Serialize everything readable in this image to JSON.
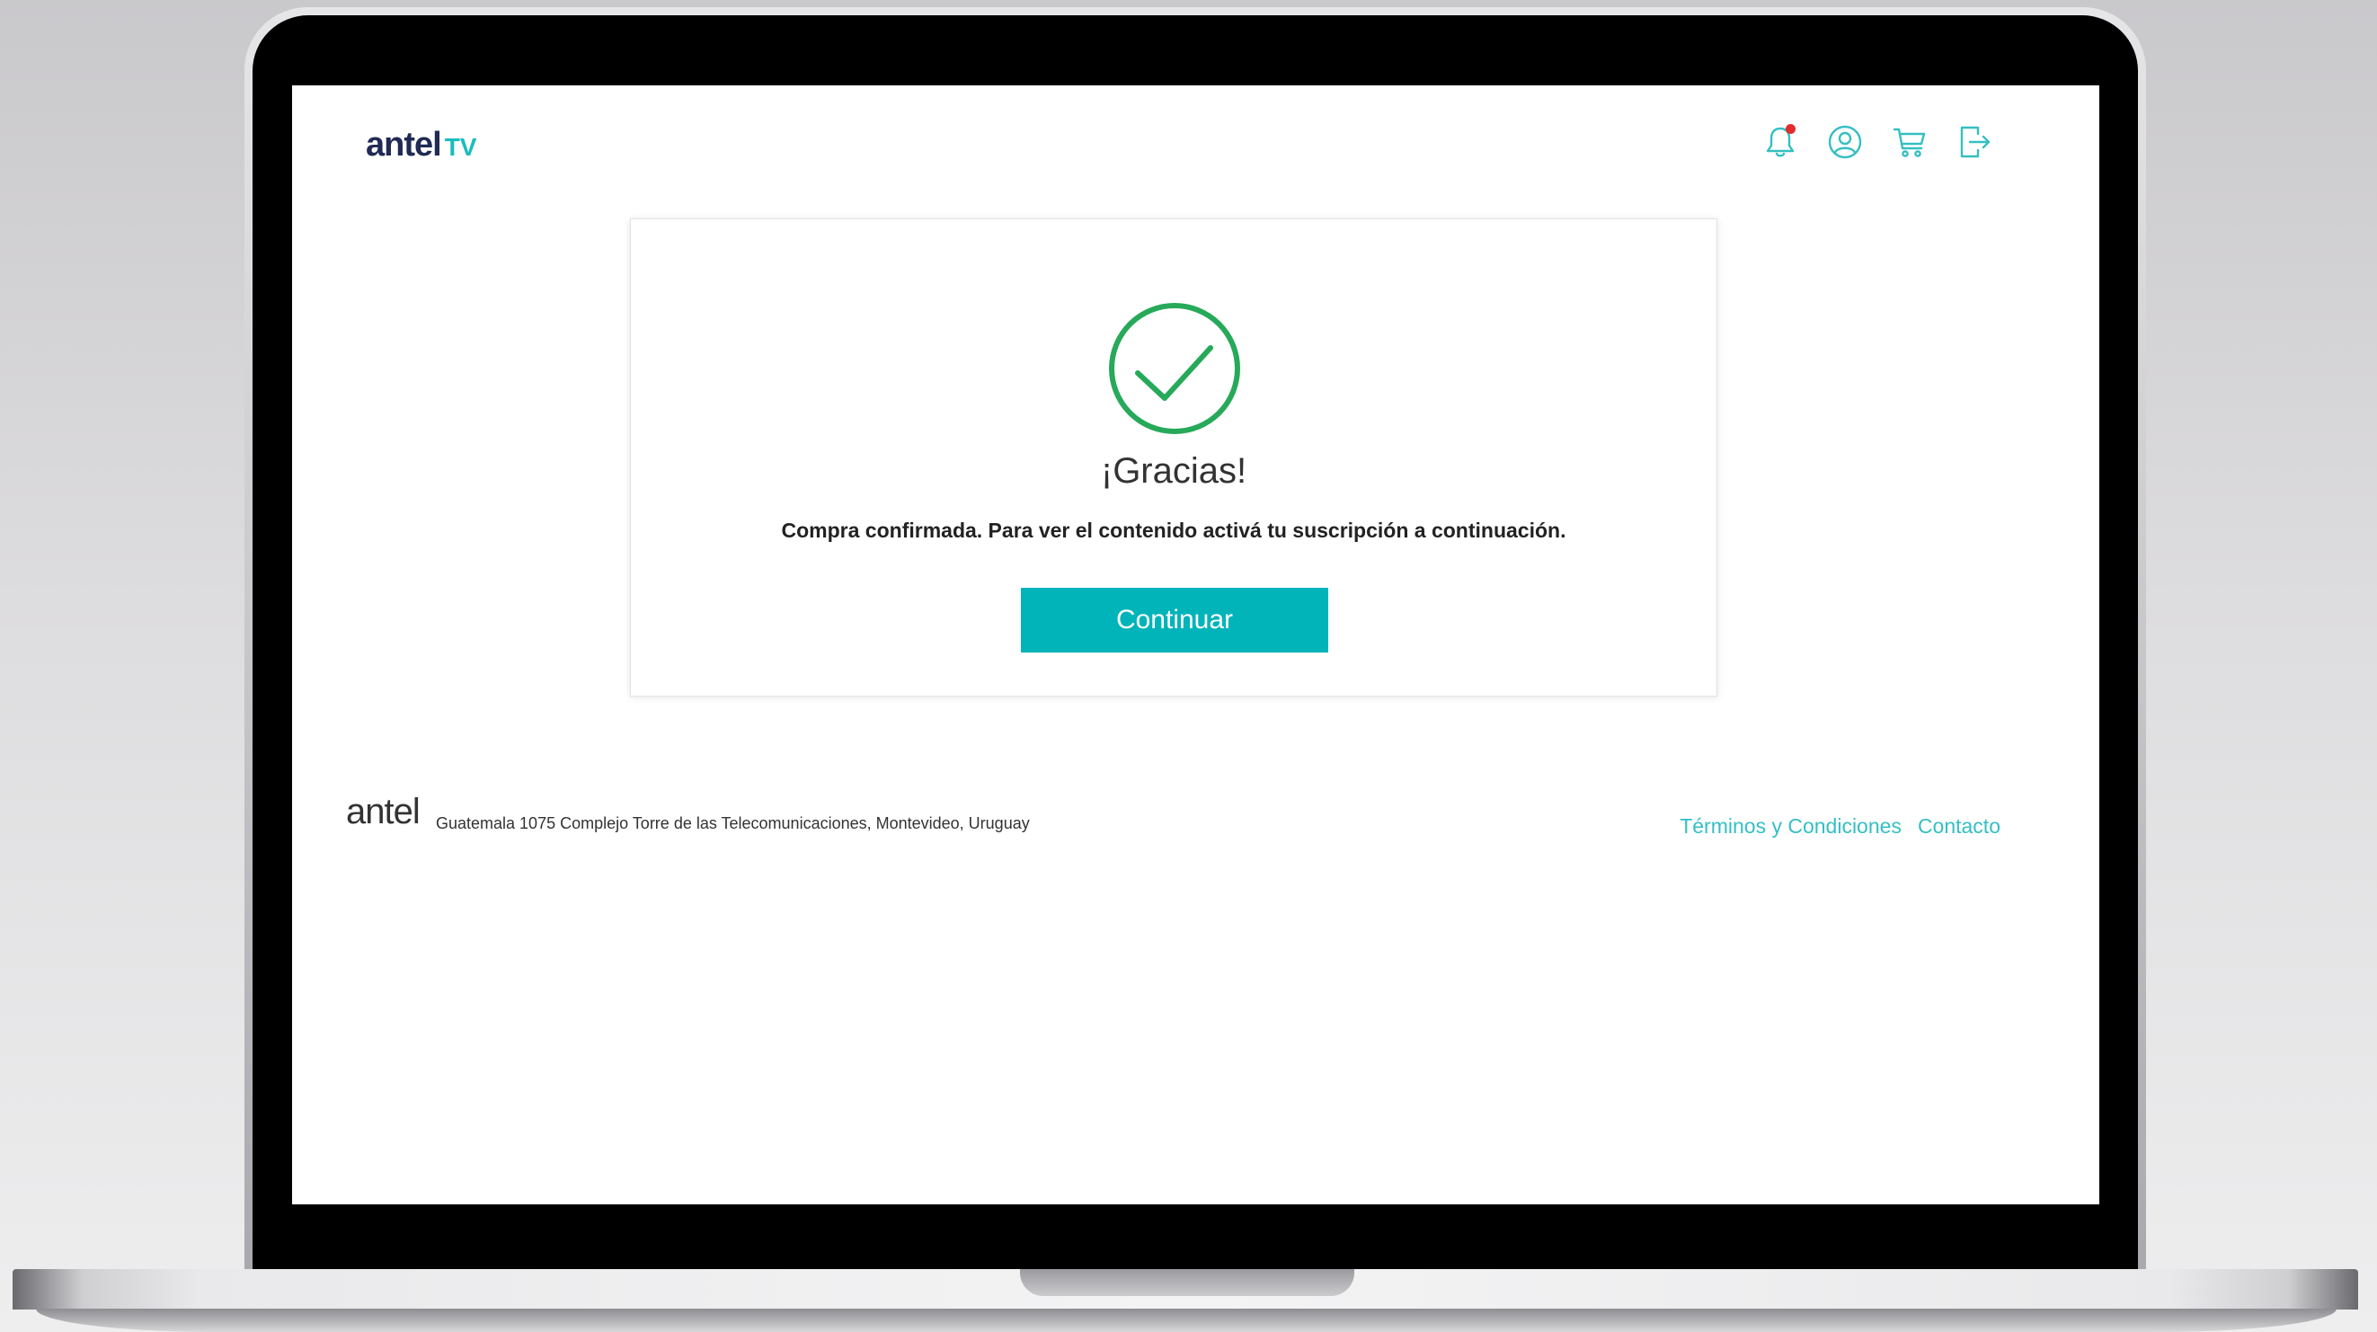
{
  "header": {
    "logo_word": "antel",
    "logo_suffix": "TV",
    "icons": [
      "bell-icon",
      "user-icon",
      "cart-icon",
      "logout-icon"
    ]
  },
  "confirmation": {
    "title": "¡Gracias!",
    "message": "Compra confirmada. Para ver el contenido activá tu suscripción a continuación.",
    "button_label": "Continuar"
  },
  "footer": {
    "logo_word": "antel",
    "address": "Guatemala 1075 Complejo Torre de las Telecomunicaciones, Montevideo, Uruguay",
    "links": [
      "Términos y Condiciones",
      "Contacto"
    ]
  },
  "colors": {
    "accent": "#00b4b9",
    "link": "#35bfc2",
    "success": "#27a95a",
    "brand_dark": "#1f2a55",
    "notification": "#e22d2d"
  }
}
